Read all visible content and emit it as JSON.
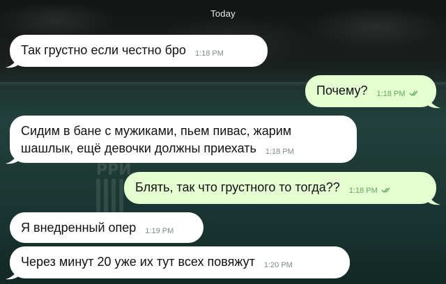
{
  "header": {
    "date_label": "Today"
  },
  "colors": {
    "incoming_bubble": "#ffffff",
    "outgoing_bubble": "#e4fdd1",
    "outgoing_meta": "#5fa95a",
    "incoming_meta": "#7e8a86"
  },
  "messages": [
    {
      "direction": "incoming",
      "text": "Так грустно если честно бро",
      "time": "1:18 PM"
    },
    {
      "direction": "outgoing",
      "text": "Почему?",
      "time": "1:18 PM",
      "status_icon": "double-check-icon"
    },
    {
      "direction": "incoming",
      "text": "Сидим в бане с мужиками, пьем пивас, жарим шашлык, ещё девочки должны приехать",
      "time": "1:18 PM"
    },
    {
      "direction": "outgoing",
      "text": "Блять, так что грустного то тогда??",
      "time": "1:18 PM",
      "status_icon": "double-check-icon"
    },
    {
      "direction": "incoming",
      "text": "Я внедренный опер",
      "time": "1:19 PM"
    },
    {
      "direction": "incoming",
      "text": "Через минут 20 уже их тут всех повяжут",
      "time": "1:20 PM"
    }
  ],
  "watermark": {
    "text": "РРИ"
  }
}
